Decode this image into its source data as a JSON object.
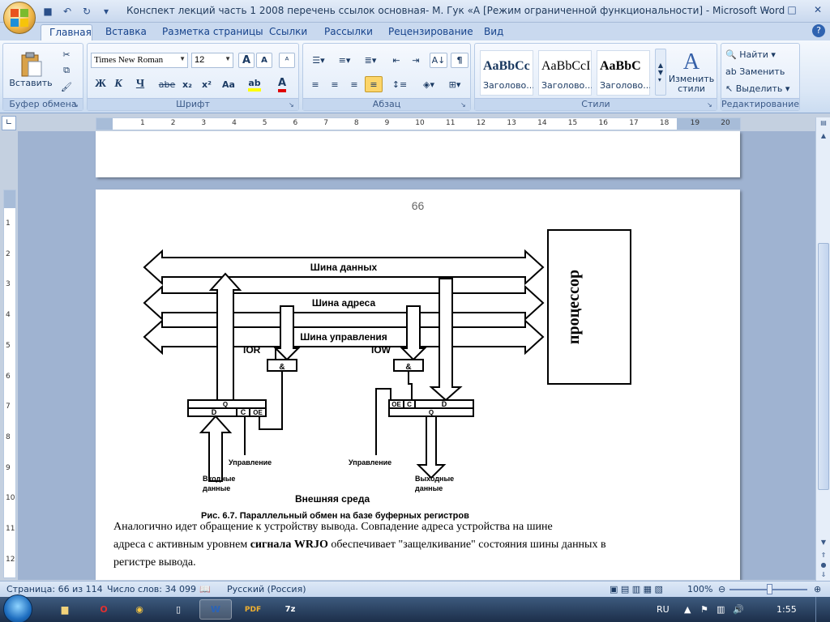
{
  "window": {
    "title": "Конспект лекций часть 1 2008 перечень ссылок основная- М. Гук «А [Режим ограниченной функциональности] - Microsoft Word"
  },
  "tabs": [
    "Главная",
    "Вставка",
    "Разметка страницы",
    "Ссылки",
    "Рассылки",
    "Рецензирование",
    "Вид"
  ],
  "ribbon": {
    "clipboard": {
      "label": "Буфер обмена",
      "paste": "Вставить"
    },
    "font": {
      "label": "Шрифт",
      "family": "Times New Roman",
      "size": "12",
      "bold": "Ж",
      "italic": "К",
      "underline": "Ч",
      "strike": "abe",
      "sub": "x₂",
      "sup": "x²",
      "case": "Aa",
      "grow": "A",
      "shrink": "A"
    },
    "paragraph": {
      "label": "Абзац",
      "pilcrow": "¶"
    },
    "styles": {
      "label": "Стили",
      "items": [
        {
          "sample": "AaBbCc",
          "name": "Заголово..."
        },
        {
          "sample": "AaBbCcI",
          "name": "Заголово..."
        },
        {
          "sample": "AaBbC",
          "name": "Заголово..."
        }
      ],
      "change_styles": "Изменить стили"
    },
    "editing": {
      "label": "Редактирование",
      "find": "Найти",
      "replace": "Заменить",
      "select": "Выделить"
    }
  },
  "ruler": {
    "h_numbers": [
      "1",
      "2",
      "3",
      "4",
      "5",
      "6",
      "7",
      "8",
      "9",
      "10",
      "11",
      "12",
      "13",
      "14",
      "15",
      "16",
      "17",
      "18",
      "19",
      "20"
    ],
    "v_numbers": [
      "1",
      "2",
      "3",
      "4",
      "5",
      "6",
      "7",
      "8",
      "9",
      "10",
      "11",
      "12"
    ]
  },
  "document": {
    "page_number": "66",
    "figure": {
      "bus_data": "Шина данных",
      "bus_address": "Шина адреса",
      "bus_control": "Шина управления",
      "processor": "процессор",
      "ior": "IOR",
      "iow": "IOW",
      "and_gate": "&",
      "reg_q": "Q",
      "reg_d": "D",
      "reg_c": "C",
      "reg_oe": "OE",
      "control_left": "Управление",
      "control_right": "Управление",
      "input_data_1": "Входные",
      "input_data_2": "данные",
      "output_data_1": "Выходные",
      "output_data_2": "данные",
      "external": "Внешняя среда",
      "caption": "Рис. 6.7. Параллельный обмен на базе буферных регистров"
    },
    "para1": "Аналогично идет обращение к устройству вывода. Совпадение адреса устройства на шине",
    "para2_a": "адреса с активным уровнем ",
    "para2_b": "сигнала WRJO",
    "para2_c": " обеспечивает \"защелкивание\" состояния шины данных в",
    "para3": "регистре вывода."
  },
  "status": {
    "page": "Страница: 66 из 114",
    "words": "Число слов: 34 099",
    "language": "Русский (Россия)",
    "zoom": "100%"
  },
  "taskbar": {
    "lang": "RU",
    "time": "1:55"
  }
}
